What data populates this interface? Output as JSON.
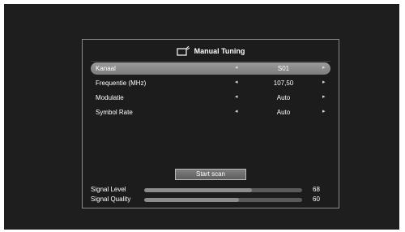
{
  "dialog": {
    "title": "Manual Tuning",
    "icon": "tv-antenna-icon",
    "rows": [
      {
        "label": "Kanaal",
        "value": "S01"
      },
      {
        "label": "Frequentie (MHz)",
        "value": "107,50"
      },
      {
        "label": "Modulatie",
        "value": "Auto"
      },
      {
        "label": "Symbol Rate",
        "value": "Auto"
      }
    ],
    "arrow_left": "◂",
    "arrow_right": "▸",
    "selected_row": 0,
    "scan_button": "Start scan"
  },
  "signal": {
    "level_label": "Signal Level",
    "level_value": "68",
    "level_fraction": 0.68,
    "quality_label": "Signal Quality",
    "quality_value": "60",
    "quality_fraction": 0.6
  },
  "colors": {
    "selected_row": "#8a8a8a",
    "background": "#1e1e1e",
    "bar_fill": "#8c8c8c",
    "bar_track": "#5a5a5a"
  }
}
